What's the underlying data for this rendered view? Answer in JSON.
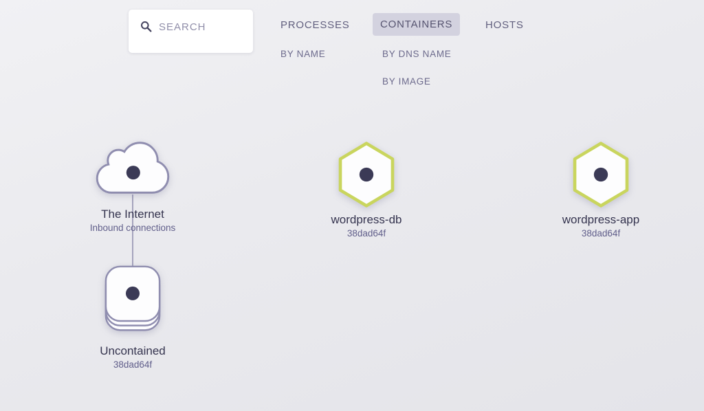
{
  "search": {
    "placeholder": "SEARCH"
  },
  "tabs": {
    "main": [
      {
        "label": "PROCESSES",
        "active": false
      },
      {
        "label": "CONTAINERS",
        "active": true
      },
      {
        "label": "HOSTS",
        "active": false
      }
    ],
    "processes_sub": [
      {
        "label": "BY NAME"
      }
    ],
    "containers_sub": [
      {
        "label": "BY DNS NAME"
      },
      {
        "label": "BY IMAGE"
      }
    ]
  },
  "graph": {
    "nodes": [
      {
        "id": "the-internet",
        "shape": "cloud",
        "label": "The Internet",
        "sublabel": "Inbound connections"
      },
      {
        "id": "wordpress-db",
        "shape": "hexagon",
        "label": "wordpress-db",
        "sublabel": "38dad64f"
      },
      {
        "id": "wordpress-app",
        "shape": "hexagon",
        "label": "wordpress-app",
        "sublabel": "38dad64f"
      },
      {
        "id": "uncontained",
        "shape": "stack",
        "label": "Uncontained",
        "sublabel": "38dad64f"
      }
    ],
    "edges": [
      {
        "from": "the-internet",
        "to": "uncontained"
      }
    ]
  },
  "colors": {
    "background": "#eaeaee",
    "node_stroke": "#8f8daf",
    "container_stroke": "#c9d55e",
    "dot": "#3b3a56",
    "active_tab_bg": "#d3d2df",
    "edge": "#a5a3bd"
  }
}
